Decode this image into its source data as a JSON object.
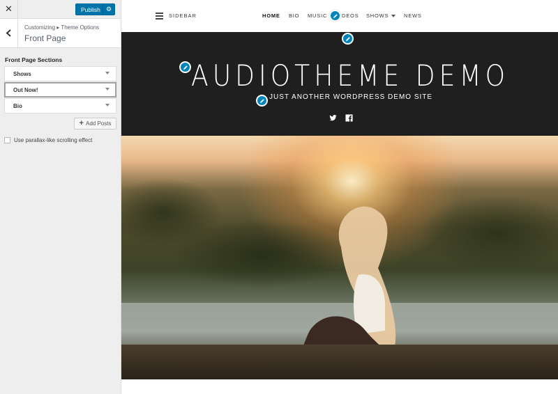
{
  "customizer": {
    "close_icon": "close-icon",
    "publish_label": "Publish",
    "gear_icon": "gear-icon",
    "breadcrumb": "Customizing ▸ Theme Options",
    "panel_title": "Front Page",
    "section_label": "Front Page Sections",
    "sections": [
      {
        "label": "Shows"
      },
      {
        "label": "Out Now!"
      },
      {
        "label": "Bio"
      }
    ],
    "add_posts_label": "Add Posts",
    "parallax_label": "Use parallax-like scrolling effect",
    "parallax_checked": false,
    "accent_color": "#0073aa"
  },
  "preview": {
    "sidebar_label": "SIDEBAR",
    "nav": [
      {
        "label": "HOME",
        "current": true
      },
      {
        "label": "BIO"
      },
      {
        "label": "MUSIC"
      },
      {
        "label": "DEOS"
      },
      {
        "label": "SHOWS"
      },
      {
        "label": "NEWS"
      }
    ],
    "site_title": "AUDIOTHEME DEMO",
    "tagline": "JUST ANOTHER WORDPRESS DEMO SITE",
    "social_icons": [
      "twitter-icon",
      "facebook-icon"
    ],
    "hero_bg": "#1f1f1f",
    "edit_shortcut_color": "#0085ba"
  }
}
